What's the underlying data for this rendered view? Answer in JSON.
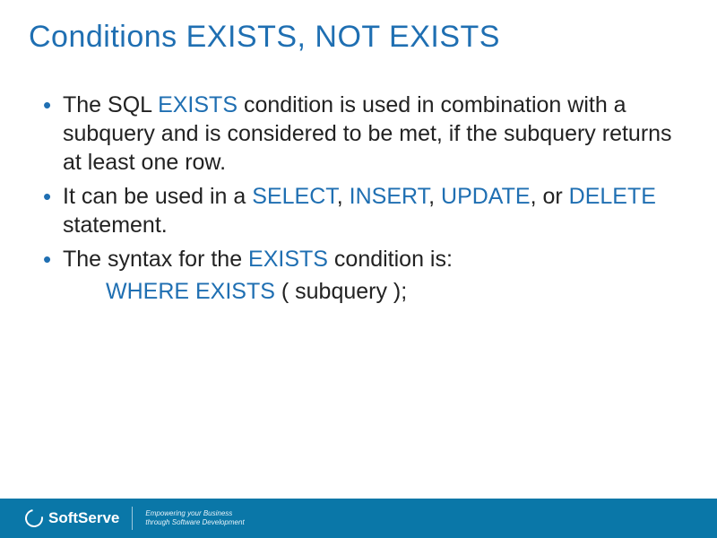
{
  "title": "Conditions EXISTS, NOT EXISTS",
  "bullets": {
    "b1": {
      "t1": "The SQL ",
      "kw1": "EXISTS",
      "t2": " condition is used in combination with a subquery and is considered to be met, if the subquery returns at least one row."
    },
    "b2": {
      "t1": "It can be used in a ",
      "kw1": "SELECT",
      "c1": ", ",
      "kw2": "INSERT",
      "c2": ", ",
      "kw3": "UPDATE",
      "c3": ", or ",
      "kw4": "DELETE",
      "t2": " statement."
    },
    "b3": {
      "t1": "The syntax for the ",
      "kw1": "EXISTS",
      "t2": " condition is:"
    }
  },
  "syntax": {
    "kw": "WHERE EXISTS",
    "rest": " ( subquery );"
  },
  "footer": {
    "brand": "SoftServe",
    "tagline_l1": "Empowering your Business",
    "tagline_l2": "through Software Development"
  }
}
